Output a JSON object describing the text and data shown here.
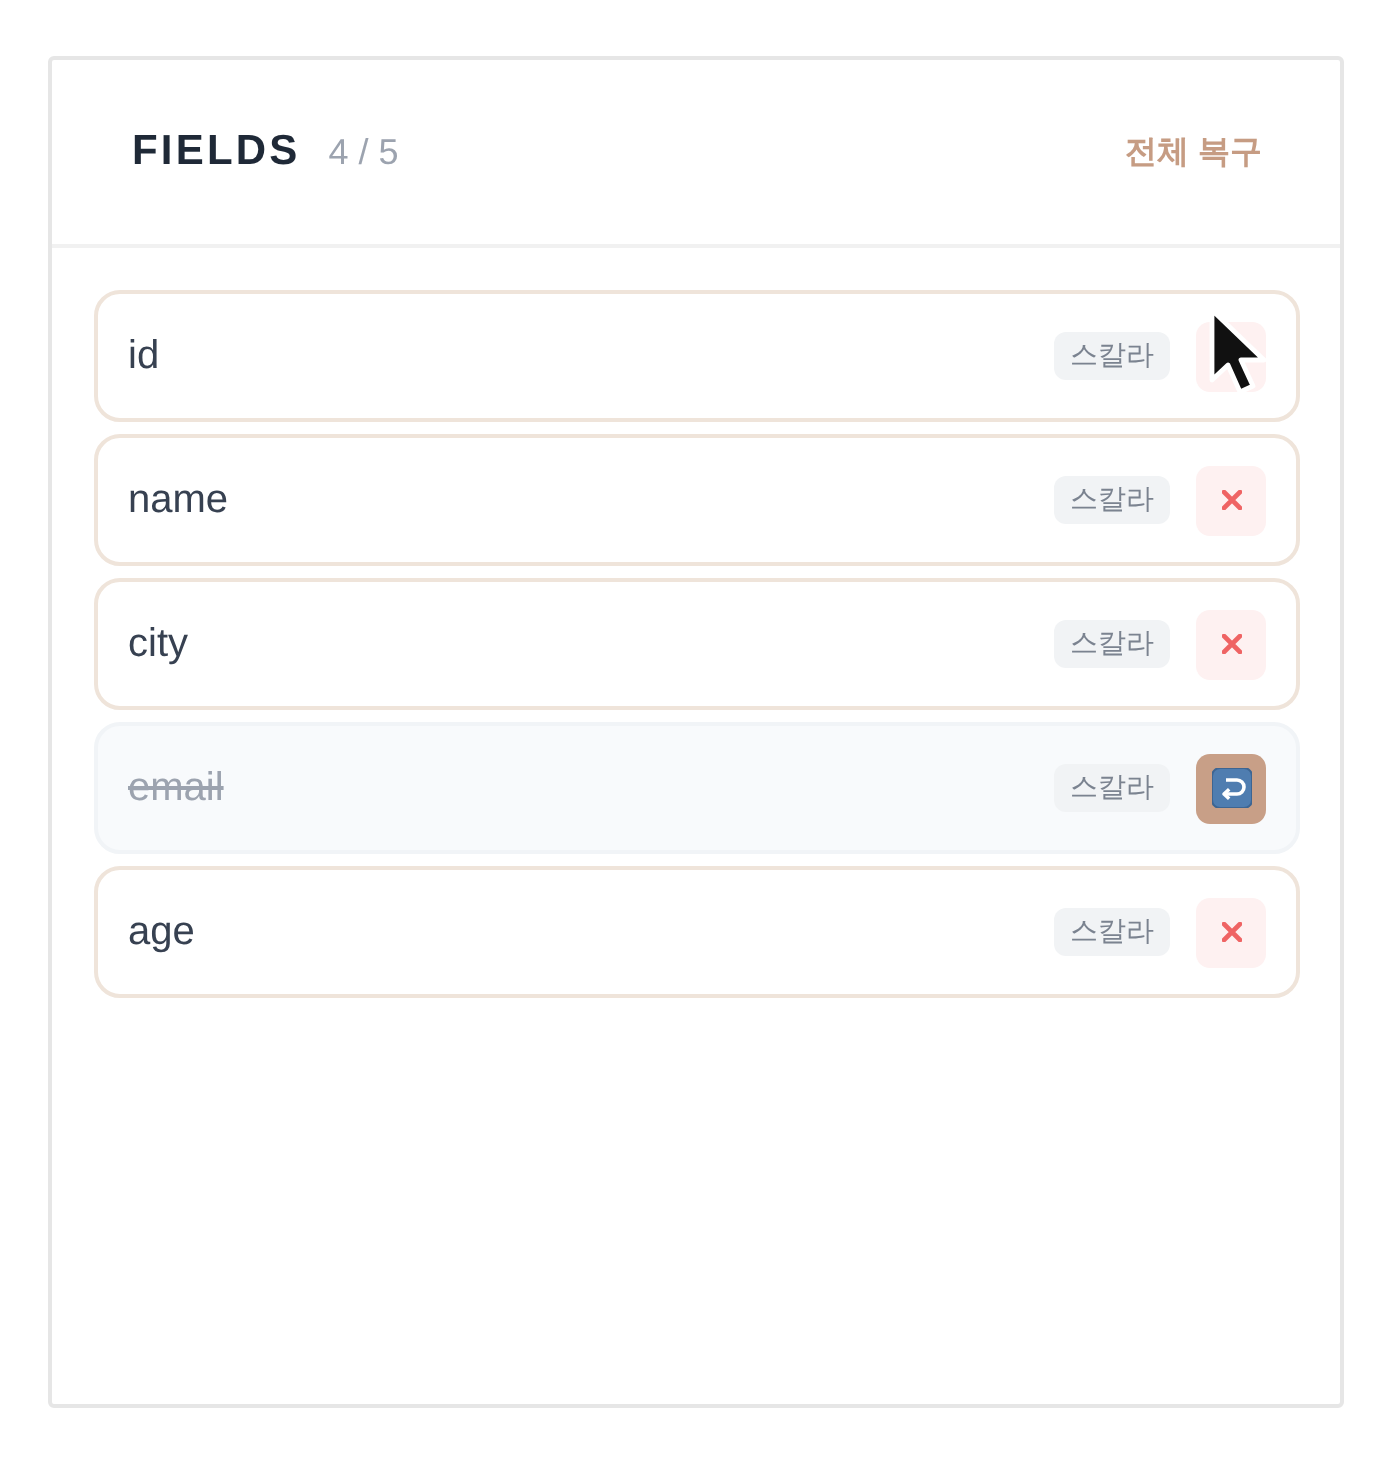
{
  "panel": {
    "title": "FIELDS",
    "count": "4 / 5",
    "restore_all": "전체 복구"
  },
  "fields": [
    {
      "name": "id",
      "type": "스칼라",
      "removed": false,
      "hovered": true
    },
    {
      "name": "name",
      "type": "스칼라",
      "removed": false,
      "hovered": false
    },
    {
      "name": "city",
      "type": "스칼라",
      "removed": false,
      "hovered": false
    },
    {
      "name": "email",
      "type": "스칼라",
      "removed": true,
      "hovered": false
    },
    {
      "name": "age",
      "type": "스칼라",
      "removed": false,
      "hovered": false
    }
  ]
}
